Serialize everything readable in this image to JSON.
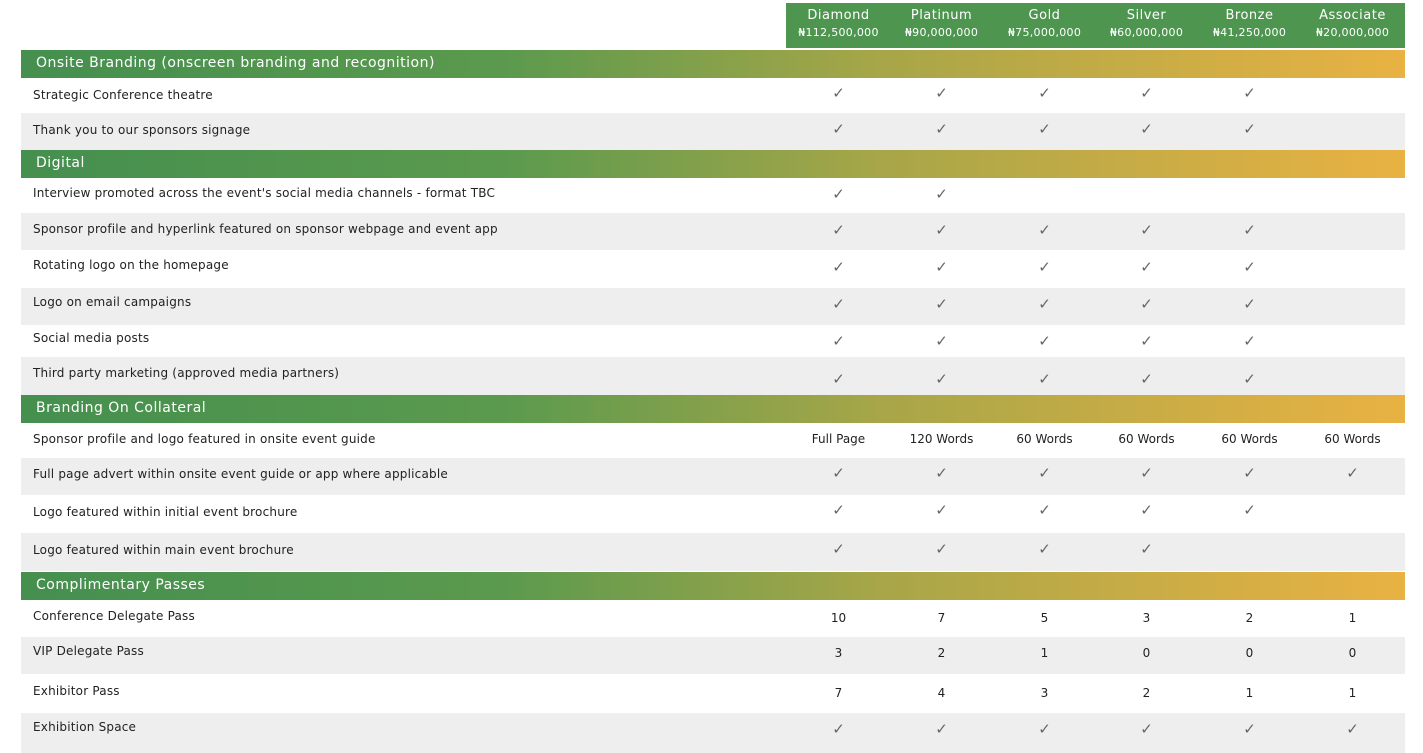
{
  "tiers": [
    {
      "name": "Diamond",
      "price": "₦112,500,000"
    },
    {
      "name": "Platinum",
      "price": "₦90,000,000"
    },
    {
      "name": "Gold",
      "price": "₦75,000,000"
    },
    {
      "name": "Silver",
      "price": "₦60,000,000"
    },
    {
      "name": "Bronze",
      "price": "₦41,250,000"
    },
    {
      "name": "Associate",
      "price": "₦20,000,000"
    }
  ],
  "check_icon": "✓",
  "colors": {
    "header_green": "#4e9650",
    "gradient_start": "#458f4f",
    "gradient_end": "#e9b243",
    "row_alt": "#eeeeee"
  },
  "sections": [
    {
      "title": "Onsite Branding (onscreen branding and recognition)",
      "rows": [
        {
          "label": "Strategic Conference theatre",
          "cells": [
            "✓",
            "✓",
            "✓",
            "✓",
            "✓",
            ""
          ]
        },
        {
          "label": "Thank you to our sponsors signage",
          "cells": [
            "✓",
            "✓",
            "✓",
            "✓",
            "✓",
            ""
          ]
        }
      ]
    },
    {
      "title": "Digital",
      "rows": [
        {
          "label": "Interview promoted across the event's social media channels - format TBC",
          "cells": [
            "✓",
            "✓",
            "",
            "",
            "",
            ""
          ]
        },
        {
          "label": "Sponsor profile and hyperlink featured on sponsor webpage and event app",
          "cells": [
            "✓",
            "✓",
            "✓",
            "✓",
            "✓",
            ""
          ]
        },
        {
          "label": "Rotating logo on the homepage",
          "cells": [
            "✓",
            "✓",
            "✓",
            "✓",
            "✓",
            ""
          ]
        },
        {
          "label": "Logo on email campaigns",
          "cells": [
            "✓",
            "✓",
            "✓",
            "✓",
            "✓",
            ""
          ]
        },
        {
          "label": "Social media posts",
          "cells": [
            "✓",
            "✓",
            "✓",
            "✓",
            "✓",
            ""
          ]
        },
        {
          "label": "Third party marketing (approved media partners)",
          "cells": [
            "✓",
            "✓",
            "✓",
            "✓",
            "✓",
            ""
          ]
        }
      ]
    },
    {
      "title": "Branding On Collateral",
      "rows": [
        {
          "label": "Sponsor profile and logo featured in onsite event guide",
          "cells": [
            "Full Page",
            "120 Words",
            "60 Words",
            "60 Words",
            "60 Words",
            "60 Words"
          ]
        },
        {
          "label": "Full page advert within onsite event guide or app where applicable",
          "cells": [
            "✓",
            "✓",
            "✓",
            "✓",
            "✓",
            "✓"
          ]
        },
        {
          "label": "Logo featured within initial event brochure",
          "cells": [
            "✓",
            "✓",
            "✓",
            "✓",
            "✓",
            ""
          ]
        },
        {
          "label": "Logo featured within main event brochure",
          "cells": [
            "✓",
            "✓",
            "✓",
            "✓",
            "",
            ""
          ]
        }
      ]
    },
    {
      "title": "Complimentary Passes",
      "rows": [
        {
          "label": "Conference Delegate Pass",
          "cells": [
            "10",
            "7",
            "5",
            "3",
            "2",
            "1"
          ]
        },
        {
          "label": "VIP Delegate Pass",
          "cells": [
            "3",
            "2",
            "1",
            "0",
            "0",
            "0"
          ]
        },
        {
          "label": "Exhibitor Pass",
          "cells": [
            "7",
            "4",
            "3",
            "2",
            "1",
            "1"
          ]
        },
        {
          "label": "Exhibition Space",
          "cells": [
            "✓",
            "✓",
            "✓",
            "✓",
            "✓",
            "✓"
          ]
        }
      ]
    }
  ]
}
